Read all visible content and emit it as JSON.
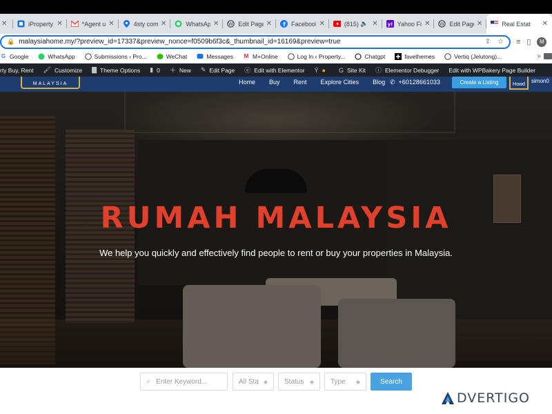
{
  "browser": {
    "tabs": [
      {
        "label": "",
        "icon": "generic-icon",
        "icon_color": "#5f6368",
        "active": false
      },
      {
        "label": "iProperty",
        "icon": "iproperty-icon",
        "icon_color": "#1a73e8",
        "active": false
      },
      {
        "label": "*Agent u",
        "icon": "gmail-icon",
        "icon_color": "#ea4335",
        "active": false
      },
      {
        "label": "4sty com",
        "icon": "maps-pin-icon",
        "icon_color": "#1a73e8",
        "active": false
      },
      {
        "label": "WhatsAp",
        "icon": "whatsapp-icon",
        "icon_color": "#25d366",
        "active": false
      },
      {
        "label": "Edit Page",
        "icon": "wordpress-icon",
        "icon_color": "#3c4043",
        "active": false
      },
      {
        "label": "Facebook",
        "icon": "facebook-icon",
        "icon_color": "#1877f2",
        "active": false
      },
      {
        "label": "(815)",
        "icon": "youtube-icon",
        "icon_color": "#ff0000",
        "active": false
      },
      {
        "label": "Yahoo Fi",
        "icon": "yahoo-icon",
        "icon_color": "#6001d2",
        "active": false
      },
      {
        "label": "Edit Page",
        "icon": "wordpress-icon",
        "icon_color": "#3c4043",
        "active": false
      },
      {
        "label": "Real Estat",
        "icon": "flag-icon",
        "icon_color": "#e8453c",
        "active": true
      }
    ],
    "url": "malaysiahome.my/?preview_id=17337&preview_nonce=f0509b6f3c&_thumbnail_id=16169&preview=true",
    "avatar_letter": "M"
  },
  "bookmarks": [
    {
      "label": "Google",
      "icon": "google-icon"
    },
    {
      "label": "WhatsApp",
      "icon": "whatsapp-icon"
    },
    {
      "label": "Submissions ‹ Pro...",
      "icon": "wordpress-icon"
    },
    {
      "label": "WeChat",
      "icon": "wechat-icon"
    },
    {
      "label": "Messages",
      "icon": "messages-icon"
    },
    {
      "label": "M+Online",
      "icon": "mplus-icon"
    },
    {
      "label": "Log In ‹ Property...",
      "icon": "wordpress-icon"
    },
    {
      "label": "Chatgpt",
      "icon": "chatgpt-icon"
    },
    {
      "label": "favethemes",
      "icon": "plus-icon"
    },
    {
      "label": "Vertiq (Jelutong)...",
      "icon": "wordpress-icon"
    }
  ],
  "wp_admin": {
    "items": [
      {
        "label": "rty Buy, Rent",
        "icon": ""
      },
      {
        "label": "Customize",
        "icon": "brush-icon"
      },
      {
        "label": "Theme Options",
        "icon": "dashboard-icon"
      },
      {
        "label": "0",
        "icon": "comment-icon"
      },
      {
        "label": "New",
        "icon": "plus-icon"
      },
      {
        "label": "Edit Page",
        "icon": "pencil-icon"
      },
      {
        "label": "Edit with Elementor",
        "icon": "elementor-icon"
      },
      {
        "label": "",
        "icon": "yoast-icon"
      },
      {
        "label": "Site Kit",
        "icon": "sitekit-icon"
      },
      {
        "label": "Elementor Debugger",
        "icon": "info-icon"
      },
      {
        "label": "Edit with WPBakery Page Builder",
        "icon": ""
      }
    ]
  },
  "site": {
    "logo_text": "MALAYSIA",
    "nav": [
      "Home",
      "Buy",
      "Rent",
      "Explore Cities",
      "Blog"
    ],
    "phone": "+60128661033",
    "create_listing": "Create a Listing",
    "user_badge": "Howd",
    "username": "simon0"
  },
  "hero": {
    "title": "RUMAH MALAYSIA",
    "subtitle": "We help you quickly and effectively find people to rent or buy your properties in Malaysia.",
    "title_color": "#e0402c"
  },
  "search": {
    "keyword_placeholder": "Enter Keyword...",
    "state": "All Sta",
    "status": "Status",
    "type": "Type",
    "button": "Search"
  },
  "watermark": "DVERTIGO"
}
